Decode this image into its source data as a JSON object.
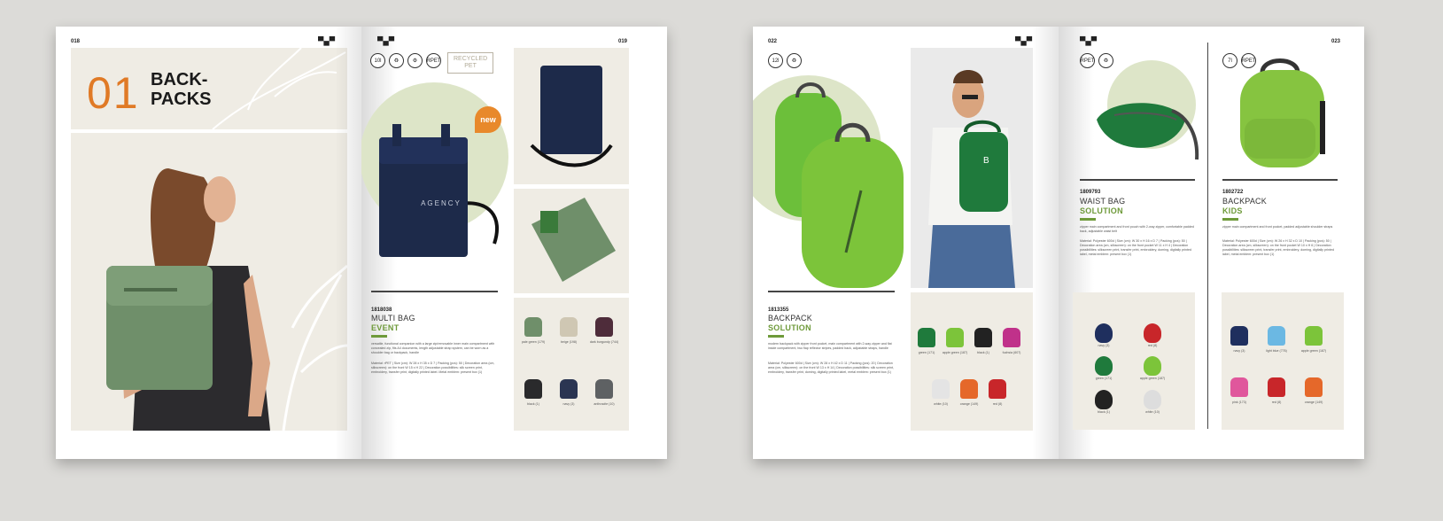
{
  "spread1": {
    "left_page": {
      "page_number": "018",
      "section_number": "01",
      "section_title_line1": "BACK-",
      "section_title_line2": "PACKS"
    },
    "right_page": {
      "page_number": "019",
      "icons": [
        "10l",
        "♻",
        "⚙",
        "RPET"
      ],
      "recycled_label_line1": "RECYCLED",
      "recycled_label_line2": "PET",
      "new_badge": "new",
      "product_brand": "AGENCY",
      "product": {
        "code": "1818038",
        "name": "MULTI BAG",
        "subname": "EVENT",
        "description_1": "versatile, functional companion with a large zip/removable inner main compartment with concealed zip, fits A4 documents, length adjustable strap system, can be worn as a shoulder bag or backpack, handle",
        "description_2": "Material: rPET | Size (cm): W 28 x H 35 x D 7 | Packing (pcs): 50 | Decoration area (cm, silkscreen): on the front W 15 x H 22 | Decoration possibilities: silk screen print, embroidery, transfer print, digitally printed label. Metal emblem: present box (1)"
      },
      "swatches": [
        {
          "label": "pale green (179)",
          "color": "#6f8f6a"
        },
        {
          "label": "beige (198)",
          "color": "#cfc7b3"
        },
        {
          "label": "dark burgundy (744)",
          "color": "#4e2c3a"
        },
        {
          "label": "black (1)",
          "color": "#2a2a2c"
        },
        {
          "label": "navy (3)",
          "color": "#2b3552"
        },
        {
          "label": "anthracite (10)",
          "color": "#5e6163"
        }
      ]
    }
  },
  "spread2": {
    "left_page": {
      "page_number": "022",
      "icons": [
        "12l",
        "♻"
      ],
      "product": {
        "code": "1813355",
        "name": "BACKPACK",
        "subname": "SOLUTION",
        "description_1": "modern backpack with zipper front pocket, main compartment with 2-way zipper and flat inside compartment, two flap reflector stripes, padded back, adjustable straps, handle",
        "description_2": "Material: Polyester 600d | Size (cm): W 28 x H 42 x D 11 | Packing (pcs): 20 | Decoration area (cm, silkscreen): on the front W 13 x H 14 | Decoration possibilities: silk screen print, embroidery, transfer print, doming, digitally printed label, metal emblem: present box (1)"
      },
      "swatches": [
        {
          "label": "green (171)",
          "color": "#1f7a3c"
        },
        {
          "label": "apple green (187)",
          "color": "#7cc43a"
        },
        {
          "label": "black (1)",
          "color": "#222"
        },
        {
          "label": "fuchsia (607)",
          "color": "#c0318a"
        },
        {
          "label": "white (10)",
          "color": "#e4e4e4"
        },
        {
          "label": "orange (149)",
          "color": "#e5682a"
        },
        {
          "label": "red (8)",
          "color": "#c8262a"
        }
      ]
    },
    "right_page": {
      "page_number": "023",
      "product_a": {
        "icons": [
          "RPET",
          "♻"
        ],
        "code": "1809793",
        "name": "WAIST BAG",
        "subname": "SOLUTION",
        "description_1": "zipper main compartment and front pouch with 2-way zipper, comfortable padded back, adjustable waist belt",
        "description_2": "Material: Polyester 600d | Size (cm): W 30 x H 16 x D 7 | Packing (pcs): 50 | Decoration area (cm, silkscreen): on the front pocket W 11 x H 4 | Decoration possibilities: silkscreen print, transfer print, embroidery, doming, digitally printed label, metal emblem: present box (1)",
        "swatches": [
          {
            "label": "navy (3)",
            "color": "#1f2f5e"
          },
          {
            "label": "red (8)",
            "color": "#c8262a"
          },
          {
            "label": "green (171)",
            "color": "#1f7a3c"
          },
          {
            "label": "apple green (187)",
            "color": "#7cc43a"
          },
          {
            "label": "black (1)",
            "color": "#222"
          },
          {
            "label": "white (10)",
            "color": "#ddd"
          }
        ]
      },
      "product_b": {
        "icons": [
          "7l",
          "RPET"
        ],
        "code": "1802722",
        "name": "BACKPACK",
        "subname": "KIDS",
        "description_1": "zipper main compartment and front pocket, padded adjustable shoulder straps",
        "description_2": "Material: Polyester 600d | Size (cm): W 26 x H 32 x D 10 | Packing (pcs): 50 | Decoration area (cm, silkscreen): on the front pocket W 10 x H 6 | Decoration possibilities: silkscreen print, transfer print, embroidery, doming, digitally printed label, metal emblem: present box (1)",
        "swatches": [
          {
            "label": "navy (3)",
            "color": "#1f2f5e"
          },
          {
            "label": "light blue (776)",
            "color": "#6bb8e3"
          },
          {
            "label": "apple green (187)",
            "color": "#7cc43a"
          },
          {
            "label": "pink (173)",
            "color": "#e0579c"
          },
          {
            "label": "red (8)",
            "color": "#c8262a"
          },
          {
            "label": "orange (149)",
            "color": "#e5682a"
          }
        ]
      }
    }
  }
}
